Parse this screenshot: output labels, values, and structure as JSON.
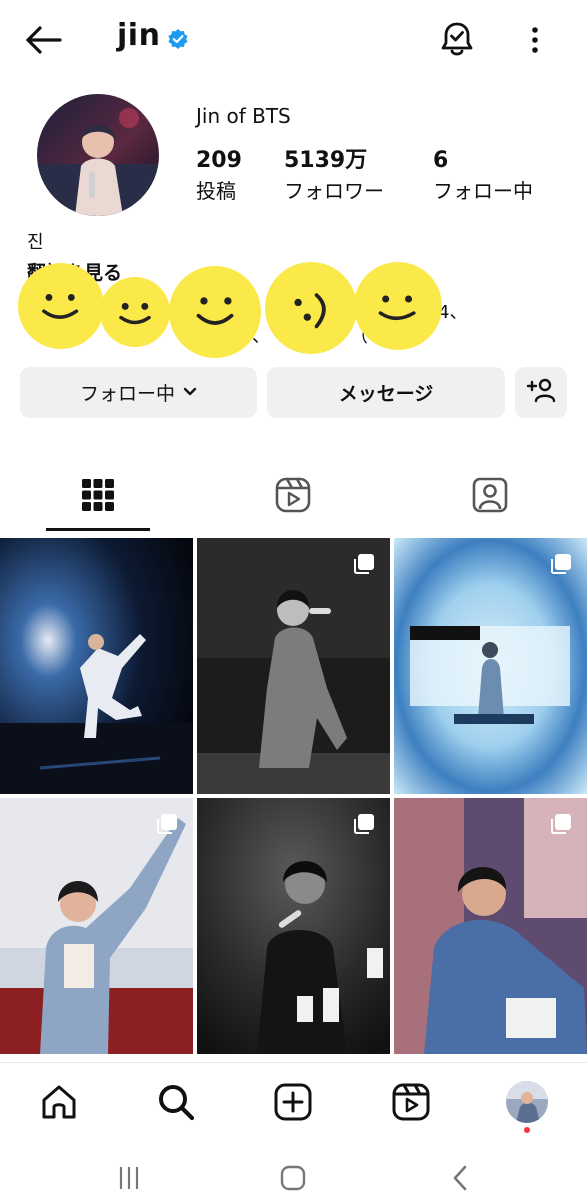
{
  "header": {
    "username": "jin",
    "verified_icon": "verified-badge-icon",
    "accent": "#1d9bf0"
  },
  "profile": {
    "display_name": "Jin of BTS",
    "stats": [
      {
        "value": "209",
        "label": "投稿"
      },
      {
        "value": "5139万",
        "label": "フォロワー"
      },
      {
        "value": "6",
        "label": "フォロー中"
      }
    ],
    "bio_name": "진",
    "translate_label": "翻訳を見る",
    "bio_fragment_1": "4、",
    "bio_fragment_2": "、",
    "bio_fragment_3": "（"
  },
  "actions": {
    "following_label": "フォロー中",
    "message_label": "メッセージ"
  },
  "tabs": [
    "grid-icon",
    "reels-icon",
    "tagged-icon"
  ],
  "posts": [
    {
      "multi": false,
      "palette": [
        "#0d1626",
        "#1e3a66",
        "#e7ecf5"
      ]
    },
    {
      "multi": true,
      "palette": [
        "#111111",
        "#5a5a5a",
        "#d6d6d6"
      ]
    },
    {
      "multi": true,
      "palette": [
        "#4a88c8",
        "#a7d3f2",
        "#e9f4fb"
      ]
    },
    {
      "multi": true,
      "palette": [
        "#7f9ab8",
        "#b9c7da",
        "#8a1f1f"
      ]
    },
    {
      "multi": true,
      "palette": [
        "#1a1a1a",
        "#3c3c3c",
        "#f2f2f2"
      ]
    },
    {
      "multi": true,
      "palette": [
        "#5b4a6e",
        "#3d5a8a",
        "#e2b3b8"
      ]
    }
  ],
  "bottom_nav": [
    "home-icon",
    "search-icon",
    "create-icon",
    "reels-icon",
    "profile-avatar"
  ],
  "colors": {
    "button_bg": "#eff0f2",
    "sticker": "#fbe94a",
    "notification": "#ff3040"
  }
}
